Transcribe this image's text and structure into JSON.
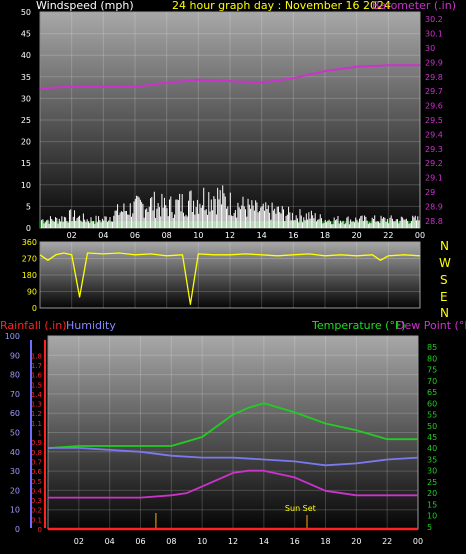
{
  "header": {
    "wind_label": "Windspeed (mph)",
    "title": "24 hour graph day : November 16 2024",
    "baro_label": "Barometer (.in)"
  },
  "rain_label": "Rainfall (.in)",
  "humidity_label": "Humidity",
  "temperature_label": "Temperature (°F)",
  "dewpoint_label": "Dew Point (°F)",
  "compass_letters": [
    "N",
    "W",
    "S",
    "E",
    "N"
  ],
  "sunset_label": "Sun Set",
  "colors": {
    "wind": "#ffffff",
    "gust_floor": "#00cc00",
    "barometer": "#cc33cc",
    "direction": "#ffff00",
    "temperature": "#22cc22",
    "humidity": "#7a7aee",
    "dewpoint": "#cc33cc",
    "rain": "#ff2222",
    "grid": "#ffffff",
    "tick_text": "#ffffff"
  },
  "chart_data": [
    {
      "type": "line",
      "panel": "wind_barometer",
      "x_tick_labels": [
        "02",
        "04",
        "06",
        "08",
        "10",
        "12",
        "14",
        "16",
        "18",
        "20",
        "22",
        "00"
      ],
      "y_left": {
        "label": "Windspeed (mph)",
        "range": [
          0,
          50
        ],
        "ticks": [
          0,
          5,
          10,
          15,
          20,
          25,
          30,
          35,
          40,
          45,
          50
        ]
      },
      "y_right": {
        "label": "Barometer (.in)",
        "range": [
          28.75,
          30.25
        ],
        "ticks": [
          "28.8",
          "28.9",
          "29",
          "29.1",
          "29.2",
          "29.3",
          "29.4",
          "29.5",
          "29.6",
          "29.7",
          "29.8",
          "29.9",
          "30",
          "30.1",
          "30.2"
        ]
      },
      "series": [
        {
          "name": "Windspeed (mph)",
          "axis": "left",
          "x": [
            0,
            1,
            2,
            3,
            4,
            5,
            6,
            7,
            8,
            9,
            10,
            11,
            12,
            13,
            14,
            15,
            16,
            17,
            18,
            19,
            20,
            21,
            22,
            23,
            24
          ],
          "y": [
            2,
            2,
            3,
            2,
            2,
            4,
            5,
            6,
            5,
            6,
            7,
            8,
            6,
            5,
            4,
            4,
            3,
            3,
            2,
            2,
            2,
            2,
            2,
            2,
            2
          ]
        },
        {
          "name": "Barometer (.in)",
          "axis": "right",
          "x": [
            0,
            2,
            4,
            6,
            8,
            10,
            12,
            14,
            16,
            18,
            20,
            22,
            24
          ],
          "y": [
            29.72,
            29.73,
            29.73,
            29.73,
            29.76,
            29.78,
            29.77,
            29.76,
            29.79,
            29.84,
            29.87,
            29.88,
            29.88
          ]
        }
      ]
    },
    {
      "type": "line",
      "panel": "wind_direction",
      "x_tick_labels": [
        "02",
        "04",
        "06",
        "08",
        "10",
        "12",
        "14",
        "16",
        "18",
        "20",
        "22",
        "00"
      ],
      "y_left": {
        "range": [
          0,
          360
        ],
        "ticks": [
          0,
          90,
          180,
          270,
          360
        ]
      },
      "series": [
        {
          "name": "Wind direction",
          "x": [
            0,
            0.5,
            1,
            1.5,
            2,
            2.5,
            3,
            4,
            5,
            6,
            7,
            8,
            9,
            9.5,
            10,
            11,
            12,
            13,
            14,
            15,
            16,
            17,
            18,
            19,
            20,
            21,
            21.5,
            22,
            23,
            24
          ],
          "y": [
            290,
            260,
            290,
            300,
            290,
            60,
            300,
            295,
            300,
            290,
            295,
            285,
            290,
            20,
            295,
            290,
            290,
            295,
            290,
            285,
            290,
            295,
            285,
            290,
            285,
            290,
            260,
            285,
            290,
            285
          ]
        }
      ]
    },
    {
      "type": "line",
      "panel": "temperature_humidity_rain",
      "x_tick_labels": [
        "02",
        "04",
        "06",
        "08",
        "10",
        "12",
        "14",
        "16",
        "18",
        "20",
        "22",
        "00"
      ],
      "y_humidity": {
        "label": "Humidity",
        "range": [
          0,
          100
        ],
        "ticks": [
          0,
          10,
          20,
          30,
          40,
          50,
          60,
          70,
          80,
          90,
          100
        ]
      },
      "y_rain": {
        "label": "Rainfall (.in)",
        "range": [
          0,
          2
        ],
        "ticks": [
          "0",
          "0.1",
          "0.2",
          "0.3",
          "0.4",
          "0.5",
          "0.6",
          "0.7",
          "0.8",
          "0.9",
          "1",
          "1.1",
          "1.2",
          "1.3",
          "1.4",
          "1.5",
          "1.6",
          "1.7",
          "1.8"
        ]
      },
      "y_temperature": {
        "label": "Temperature (°F)",
        "range": [
          4,
          90
        ],
        "ticks": [
          5,
          10,
          15,
          20,
          25,
          30,
          35,
          40,
          45,
          50,
          55,
          60,
          65,
          70,
          75,
          80,
          85
        ]
      },
      "series": [
        {
          "name": "Temperature (°F)",
          "axis": "temperature",
          "x": [
            0,
            2,
            4,
            6,
            8,
            10,
            12,
            13,
            14,
            16,
            18,
            20,
            21,
            22,
            23,
            24
          ],
          "y": [
            40,
            41,
            41,
            41,
            41,
            45,
            55,
            58,
            60,
            56,
            51,
            48,
            46,
            44,
            44,
            44
          ]
        },
        {
          "name": "Humidity",
          "axis": "humidity",
          "x": [
            0,
            2,
            4,
            6,
            8,
            10,
            12,
            14,
            16,
            17,
            18,
            20,
            22,
            24
          ],
          "y": [
            42,
            42,
            41,
            40,
            38,
            37,
            37,
            36,
            35,
            34,
            33,
            34,
            36,
            37
          ]
        },
        {
          "name": "Dew Point (°F)",
          "axis": "temperature",
          "x": [
            0,
            2,
            4,
            6,
            8,
            9,
            10,
            12,
            13,
            14,
            16,
            18,
            20,
            22,
            24
          ],
          "y": [
            18,
            18,
            18,
            18,
            19,
            20,
            23,
            29,
            30,
            30,
            27,
            21,
            19,
            19,
            19
          ]
        },
        {
          "name": "Rainfall (.in)",
          "axis": "rain",
          "x": [
            0,
            24
          ],
          "y": [
            0,
            0
          ]
        }
      ],
      "annotations": [
        {
          "text": "Sun Set",
          "x": 16.5
        }
      ]
    }
  ]
}
